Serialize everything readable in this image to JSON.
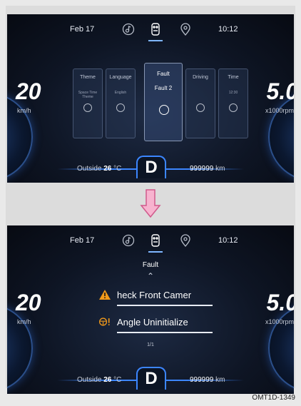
{
  "colors": {
    "accent": "#3c86ff",
    "warning_orange": "#f29a1a",
    "arrow_pink": "#f7b3cf"
  },
  "screen1": {
    "date": "Feb 17",
    "time": "10:12",
    "speed": "20",
    "speed_unit": "km/h",
    "rpm": "5.0",
    "rpm_unit": "x1000rpm",
    "outside_label": "Outside",
    "outside_temp": "26",
    "outside_unit": "°C",
    "gear": "D",
    "odometer": "999999",
    "odometer_unit": "km",
    "menu": {
      "theme": {
        "title": "Theme",
        "sub": "Space Time Theme"
      },
      "language": {
        "title": "Language",
        "sub": "English"
      },
      "fault": {
        "title": "Fault",
        "sub": "Fault 2"
      },
      "driving": {
        "title": "Driving",
        "sub": ""
      },
      "time": {
        "title": "Time",
        "sub": "12:30"
      }
    }
  },
  "screen2": {
    "date": "Feb 17",
    "time": "10:12",
    "speed": "20",
    "speed_unit": "km/h",
    "rpm": "5.0",
    "rpm_unit": "x1000rpm",
    "outside_label": "Outside",
    "outside_temp": "26",
    "outside_unit": "°C",
    "gear": "D",
    "odometer": "999999",
    "odometer_unit": "km",
    "fault_title": "Fault",
    "faults": [
      {
        "text": "heck Front Camer",
        "icon": "warning-triangle-icon"
      },
      {
        "text": "Angle Uninitialize",
        "icon": "steering-warning-icon"
      }
    ],
    "page_count": "1/1"
  },
  "caption": "OMT1D-1349"
}
